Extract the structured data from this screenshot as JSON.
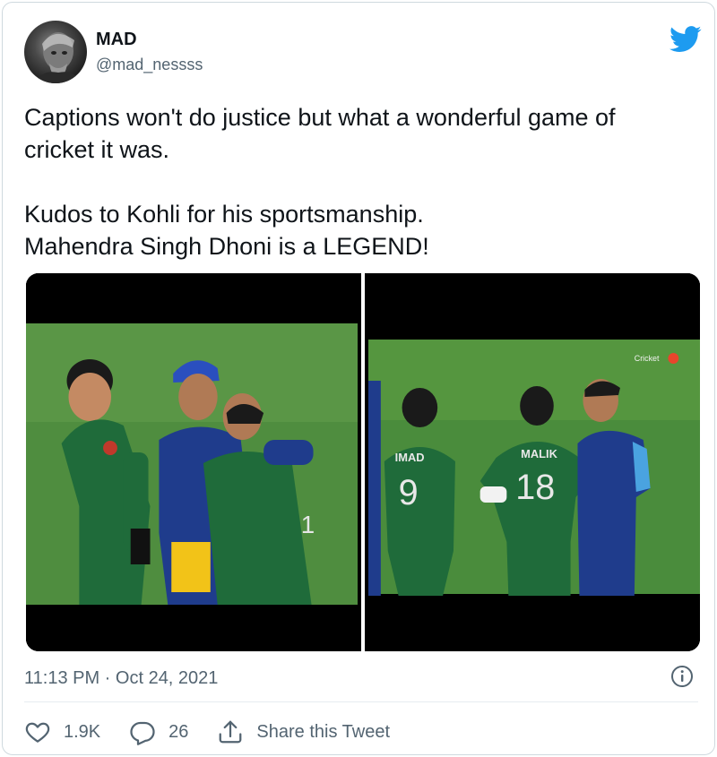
{
  "user": {
    "display_name": "MAD",
    "handle": "@mad_nessss"
  },
  "tweet": {
    "text": "Captions won't do justice but what a wonderful game of\ncricket it was.\n\nKudos to Kohli for his sportsmanship.\nMahendra Singh Dhoni is a LEGEND!",
    "timestamp": "11:13 PM · Oct 24, 2021"
  },
  "media": {
    "right_jersey_labels": {
      "player_left_name": "IMAD",
      "player_left_number": "9",
      "player_right_name": "MALIK",
      "player_right_number": "18",
      "broadcaster_bug": "Cricket"
    },
    "left_jersey_number": "1"
  },
  "actions": {
    "likes": "1.9K",
    "replies": "26",
    "share_label": "Share this Tweet"
  },
  "icons": {
    "brand": "twitter-bird-icon",
    "info": "info-icon",
    "like": "heart-icon",
    "reply": "reply-bubble-icon",
    "share": "share-icon"
  },
  "colors": {
    "twitter_blue": "#1d9bf0",
    "secondary_text": "#536471",
    "pakistan_green": "#1f6b3a",
    "india_blue": "#1f3c8c",
    "pitch_green": "#3f8a3a"
  }
}
